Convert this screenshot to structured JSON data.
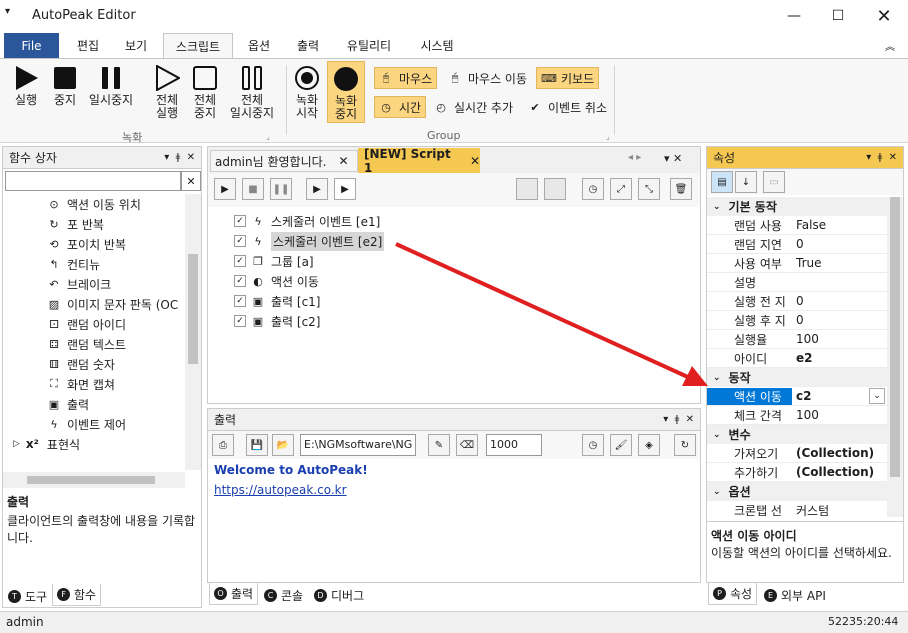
{
  "app": {
    "title": "AutoPeak Editor"
  },
  "menu": {
    "file": "File",
    "items": [
      "편집",
      "보기",
      "스크립트",
      "옵션",
      "출력",
      "유틸리티",
      "시스템"
    ]
  },
  "ribbon": {
    "buttons": [
      [
        "실행",
        ""
      ],
      [
        "중지",
        ""
      ],
      [
        "일시중지",
        ""
      ],
      [
        "전체",
        "실행"
      ],
      [
        "전체",
        "중지"
      ],
      [
        "전체",
        "일시중지"
      ],
      [
        "녹화",
        "시작"
      ],
      [
        "녹화",
        "중지"
      ]
    ],
    "group1": "녹화",
    "group2": "Group",
    "small": [
      "마우스",
      "마우스 이동",
      "키보드",
      "시간",
      "실시간 추가",
      "이벤트 취소"
    ]
  },
  "funcbox": {
    "title": "함수 상자",
    "items": [
      "액션 이동 위치",
      "포 반복",
      "포이치 반복",
      "컨티뉴",
      "브레이크",
      "이미지 문자 판독 (OC",
      "랜덤 아이디",
      "랜덤 텍스트",
      "랜덤 숫자",
      "화면 캡쳐",
      "출력",
      "이벤트 제어"
    ],
    "group": "표현식",
    "desc_title": "출력",
    "desc": "클라이언트의 출력창에 내용을 기록합니다.",
    "tabs": [
      "도구",
      "함수"
    ]
  },
  "editor": {
    "tabs": [
      "admin님 환영합니다.",
      "[NEW] Script 1"
    ],
    "items": [
      "스케줄러 이벤트 [e1]",
      "스케줄러 이벤트 [e2]",
      "그룹 [a]",
      "액션 이동",
      "출력 [c1]",
      "출력 [c2]"
    ]
  },
  "output": {
    "title": "출력",
    "path": "E:\\NGMsoftware\\NG",
    "count": "1000",
    "line1": "Welcome to AutoPeak!",
    "line2": "https://autopeak.co.kr",
    "tabs": [
      "출력",
      "콘솔",
      "디버그"
    ]
  },
  "props": {
    "title": "속성",
    "cats": [
      "기본 동작",
      "동작",
      "변수",
      "옵션"
    ],
    "rows": [
      [
        "랜덤 사용",
        "False"
      ],
      [
        "랜덤 지연",
        "0"
      ],
      [
        "사용 여부",
        "True"
      ],
      [
        "설명",
        ""
      ],
      [
        "실행 전 지",
        "0"
      ],
      [
        "실행 후 지",
        "0"
      ],
      [
        "실행율",
        "100"
      ],
      [
        "아이디",
        "e2"
      ]
    ],
    "rows2": [
      [
        "액션 이동",
        "c2"
      ],
      [
        "체크 간격",
        "100"
      ]
    ],
    "rows3": [
      [
        "가져오기",
        "(Collection)"
      ],
      [
        "추가하기",
        "(Collection)"
      ]
    ],
    "rows4": [
      [
        "크론탭 선",
        "커스텀"
      ]
    ],
    "desc_title": "액션 이동 아이디",
    "desc": "이동할 액션의 아이디를 선택하세요.",
    "tabs": [
      "속성",
      "외부 API"
    ]
  },
  "status": {
    "user": "admin",
    "time": "52235:20:44"
  },
  "colors": {
    "accent": "#2b579a",
    "highlight": "#f5c852",
    "arrow": "#e02020"
  }
}
